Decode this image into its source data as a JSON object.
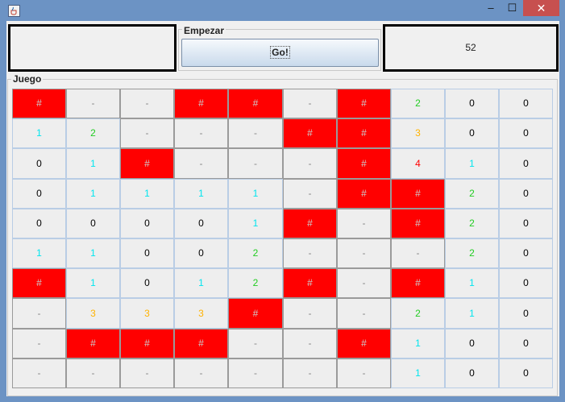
{
  "titlebar": {
    "minimize": "–",
    "maximize": "☐",
    "close": "✕",
    "icon": "java-coffee-icon"
  },
  "start": {
    "title": "Empezar",
    "button_label": "Go!"
  },
  "score": {
    "value": "52"
  },
  "game": {
    "title": "Juego",
    "rows": [
      [
        "#",
        "-",
        "-",
        "#",
        "#",
        "-",
        "#",
        "2",
        "0",
        "0"
      ],
      [
        "1",
        "2",
        "-",
        "-",
        "-",
        "#",
        "#",
        "3",
        "0",
        "0"
      ],
      [
        "0",
        "1",
        "#",
        "-",
        "-",
        "-",
        "#",
        "4",
        "1",
        "0"
      ],
      [
        "0",
        "1",
        "1",
        "1",
        "1",
        "-",
        "#",
        "#",
        "2",
        "0"
      ],
      [
        "0",
        "0",
        "0",
        "0",
        "1",
        "#",
        "-",
        "#",
        "2",
        "0"
      ],
      [
        "1",
        "1",
        "0",
        "0",
        "2",
        "-",
        "-",
        "-",
        "2",
        "0"
      ],
      [
        "#",
        "1",
        "0",
        "1",
        "2",
        "#",
        "-",
        "#",
        "1",
        "0"
      ],
      [
        "-",
        "3",
        "3",
        "3",
        "#",
        "-",
        "-",
        "2",
        "1",
        "0"
      ],
      [
        "-",
        "#",
        "#",
        "#",
        "-",
        "-",
        "#",
        "1",
        "0",
        "0"
      ],
      [
        "-",
        "-",
        "-",
        "-",
        "-",
        "-",
        "-",
        "1",
        "0",
        "0"
      ]
    ]
  },
  "colors": {
    "mine_bg": "#ff0000",
    "cell_bg": "#eeeeee",
    "num_1": "#00e5ee",
    "num_2": "#22cc22",
    "num_3": "#ffb300",
    "num_4": "#ff0000",
    "num_0": "#000000",
    "hidden_text": "#888888",
    "mine_text": "#cccccc"
  }
}
